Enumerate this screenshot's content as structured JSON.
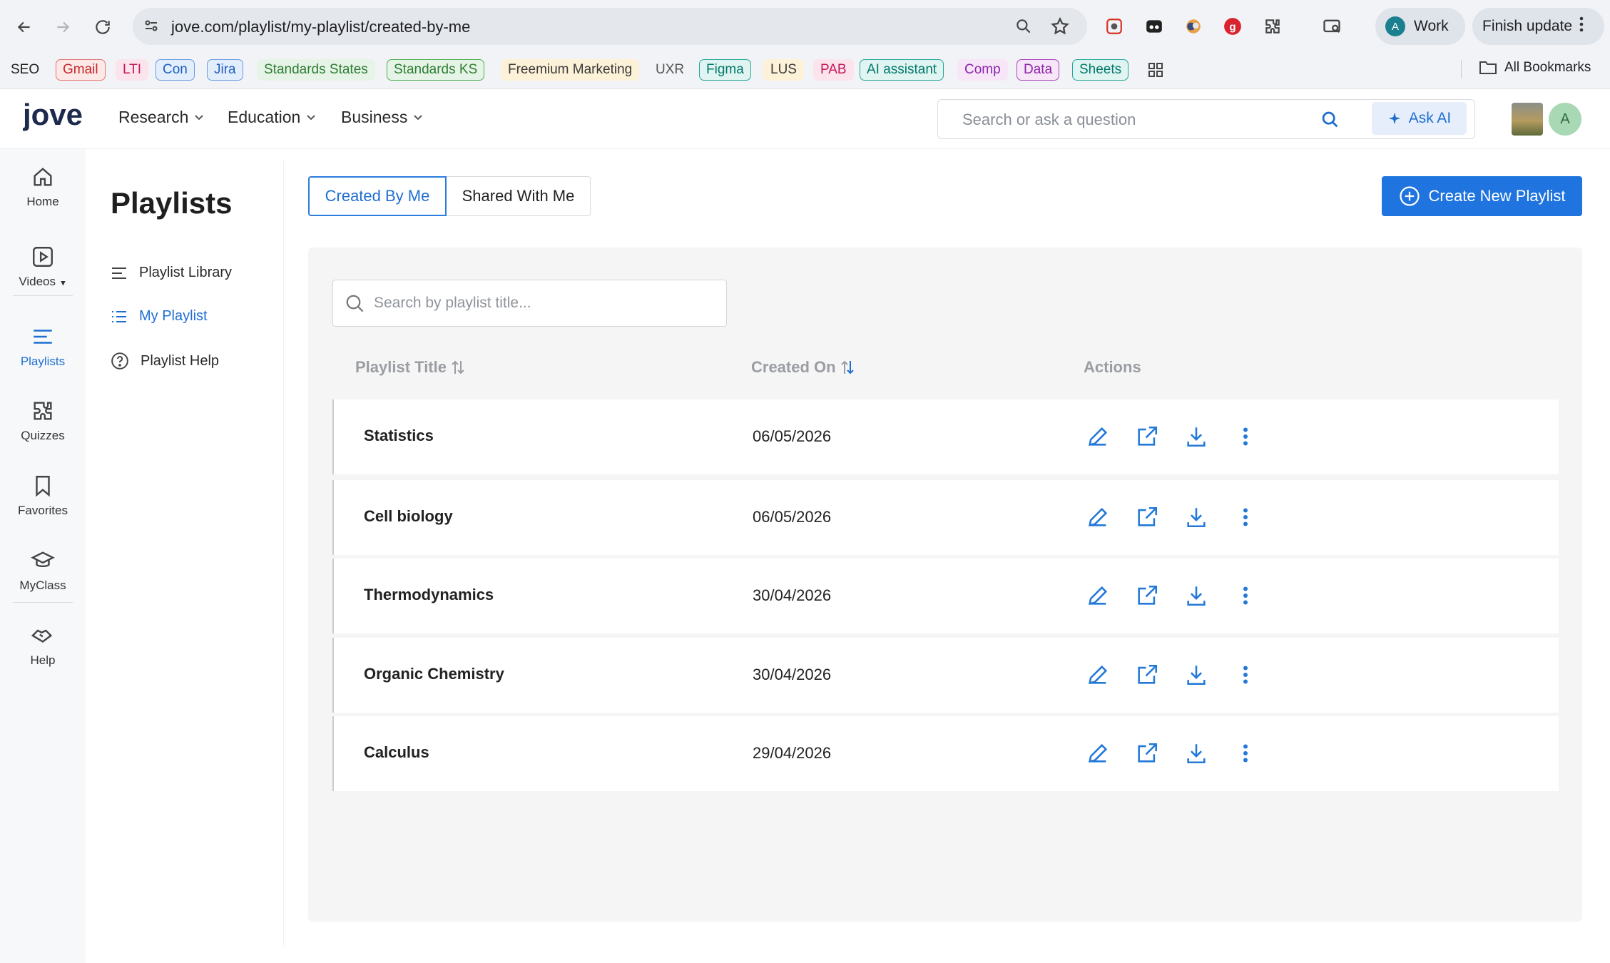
{
  "browser": {
    "url": "jove.com/playlist/my-playlist/created-by-me",
    "profile_initial": "A",
    "profile_label": "Work",
    "update_label": "Finish update",
    "bookmarks": [
      {
        "label": "SEO",
        "color": "#1f1f1f",
        "bg": "transparent",
        "border": "none"
      },
      {
        "label": "Gmail",
        "color": "#c62828",
        "bg": "#fde8e8",
        "border": "#e57373"
      },
      {
        "label": "LTI",
        "color": "#c2185b",
        "bg": "#fce4ec",
        "border": "none"
      },
      {
        "label": "Con",
        "color": "#1f5fbf",
        "bg": "#e3eefc",
        "border": "#6a9be0"
      },
      {
        "label": "Jira",
        "color": "#1f5fbf",
        "bg": "#e3eefc",
        "border": "#6a9be0"
      },
      {
        "label": "Standards States",
        "color": "#2e7d32",
        "bg": "#e6f4e7",
        "border": "none"
      },
      {
        "label": "Standards KS",
        "color": "#2e7d32",
        "bg": "#e6f4e7",
        "border": "#4caf50"
      },
      {
        "label": "Freemium Marketing",
        "color": "#3a3a3a",
        "bg": "#fdf1d8",
        "border": "none"
      },
      {
        "label": "UXR",
        "color": "#555",
        "bg": "transparent",
        "border": "none"
      },
      {
        "label": "Figma",
        "color": "#00796b",
        "bg": "#e0f4f1",
        "border": "#26a69a"
      },
      {
        "label": "LUS",
        "color": "#3a3a3a",
        "bg": "#fdf1d8",
        "border": "none"
      },
      {
        "label": "PAB",
        "color": "#c2185b",
        "bg": "#fce4ec",
        "border": "none"
      },
      {
        "label": "AI assistant",
        "color": "#00796b",
        "bg": "#e0f4f1",
        "border": "#26a69a"
      },
      {
        "label": "Comp",
        "color": "#8e24aa",
        "bg": "#f6e6f8",
        "border": "none"
      },
      {
        "label": "Data",
        "color": "#8e24aa",
        "bg": "#f6e6f8",
        "border": "#ab47bc"
      },
      {
        "label": "Sheets",
        "color": "#00796b",
        "bg": "#e0f4f1",
        "border": "#26a69a"
      }
    ],
    "all_bookmarks": "All Bookmarks"
  },
  "header": {
    "logo": "jove",
    "nav": [
      "Research",
      "Education",
      "Business"
    ],
    "search_placeholder": "Search or ask a question",
    "ask_ai": "Ask AI",
    "user_initial": "A"
  },
  "rail": [
    {
      "label": "Home",
      "icon": "home-icon"
    },
    {
      "label": "Videos",
      "icon": "video-icon"
    },
    {
      "label": "Playlists",
      "icon": "playlist-icon",
      "active": true
    },
    {
      "label": "Quizzes",
      "icon": "puzzle-icon"
    },
    {
      "label": "Favorites",
      "icon": "bookmark-icon"
    },
    {
      "label": "MyClass",
      "icon": "graduation-cap-icon"
    },
    {
      "label": "Help",
      "icon": "handshake-icon"
    }
  ],
  "panel": {
    "title": "Playlists",
    "items": [
      {
        "label": "Playlist Library"
      },
      {
        "label": "My Playlist",
        "active": true
      },
      {
        "label": "Playlist Help"
      }
    ]
  },
  "main": {
    "tabs": [
      "Created By Me",
      "Shared With Me"
    ],
    "create_button": "Create New Playlist",
    "search_placeholder": "Search by playlist title...",
    "columns": [
      "Playlist Title",
      "Created On",
      "Actions"
    ],
    "rows": [
      {
        "title": "Statistics",
        "date": "06/05/2026"
      },
      {
        "title": "Cell biology",
        "date": "06/05/2026"
      },
      {
        "title": "Thermodynamics",
        "date": "30/04/2026"
      },
      {
        "title": "Organic Chemistry",
        "date": "30/04/2026"
      },
      {
        "title": "Calculus",
        "date": "29/04/2026"
      }
    ]
  },
  "colors": {
    "accent": "#1f74e0",
    "accent_text": "#1f6fd1"
  }
}
